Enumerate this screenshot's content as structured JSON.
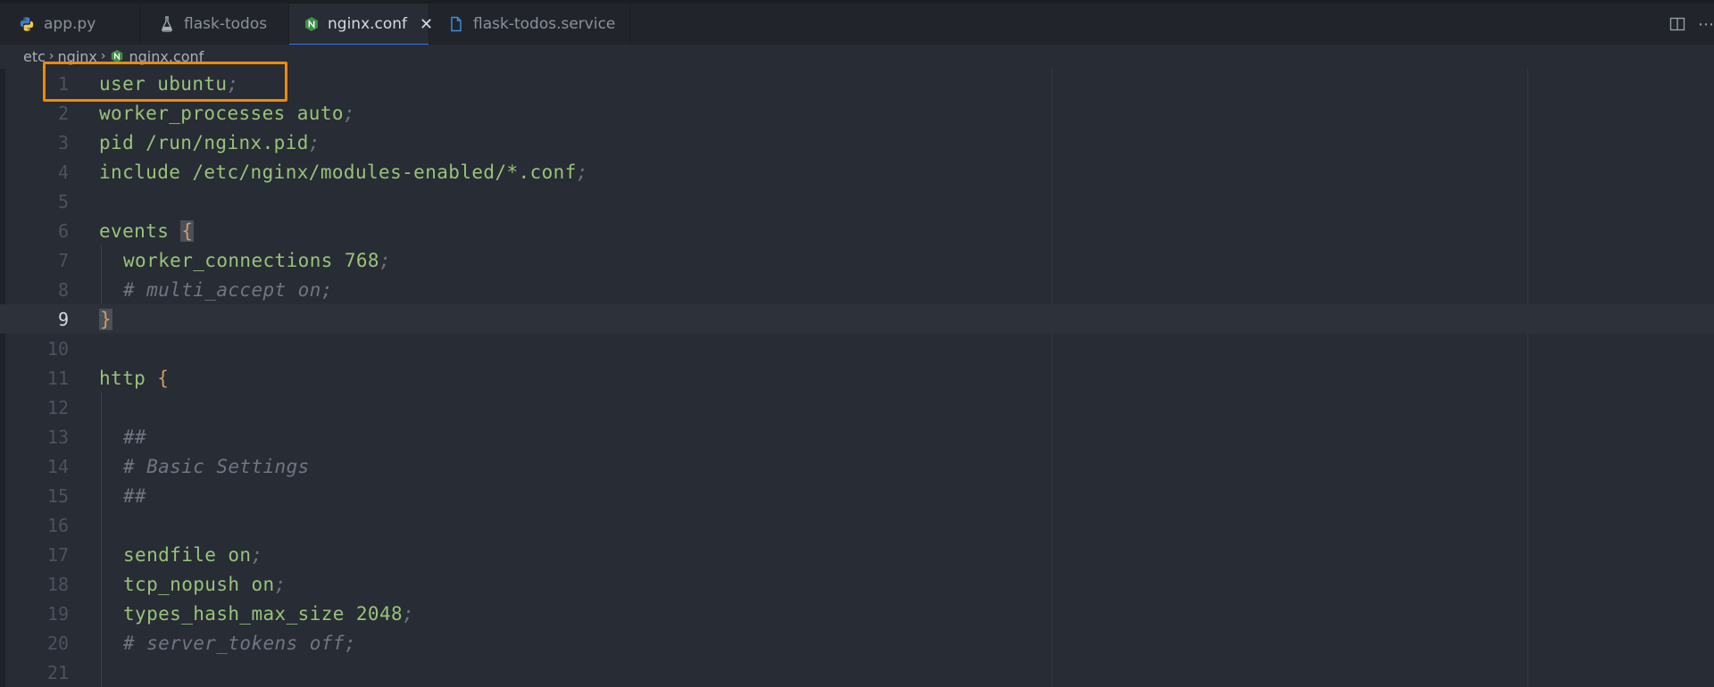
{
  "tabs": [
    {
      "label": "app.py",
      "icon": "python-icon",
      "active": false
    },
    {
      "label": "flask-todos",
      "icon": "flask-icon",
      "active": false
    },
    {
      "label": "nginx.conf",
      "icon": "nginx-icon",
      "active": true,
      "close": "✕"
    },
    {
      "label": "flask-todos.service",
      "icon": "file-icon",
      "active": false
    }
  ],
  "actions": {
    "split": "split-editor-icon",
    "more": "⋯"
  },
  "breadcrumb": {
    "parts": [
      "etc",
      "nginx",
      "nginx.conf"
    ],
    "separator": "›"
  },
  "editor": {
    "current_line": 9,
    "highlighted_line": 1,
    "lines": [
      {
        "n": "1",
        "code": "user ubuntu",
        "semi": ";"
      },
      {
        "n": "2",
        "code": "worker_processes auto",
        "semi": ";"
      },
      {
        "n": "3",
        "code": "pid /run/nginx.pid",
        "semi": ";"
      },
      {
        "n": "4",
        "code": "include /etc/nginx/modules-enabled/*.conf",
        "semi": ";"
      },
      {
        "n": "5",
        "code": "",
        "semi": ""
      },
      {
        "n": "6",
        "code": "events ",
        "brace": "{"
      },
      {
        "n": "7",
        "code": "worker_connections 768",
        "semi": ";"
      },
      {
        "n": "8",
        "comment": "# multi_accept on;"
      },
      {
        "n": "9",
        "brace": "}"
      },
      {
        "n": "10",
        "code": "",
        "semi": ""
      },
      {
        "n": "11",
        "code": "http ",
        "brace": "{"
      },
      {
        "n": "12",
        "code": "",
        "semi": ""
      },
      {
        "n": "13",
        "comment": "##"
      },
      {
        "n": "14",
        "comment": "# Basic Settings"
      },
      {
        "n": "15",
        "comment": "##"
      },
      {
        "n": "16",
        "code": "",
        "semi": ""
      },
      {
        "n": "17",
        "code": "sendfile on",
        "semi": ";"
      },
      {
        "n": "18",
        "code": "tcp_nopush on",
        "semi": ";"
      },
      {
        "n": "19",
        "code": "types_hash_max_size 2048",
        "semi": ";"
      },
      {
        "n": "20",
        "comment": "# server_tokens off;"
      },
      {
        "n": "21",
        "code": "",
        "semi": ""
      }
    ]
  },
  "colors": {
    "accent": "#f08a00",
    "keyword": "#98c379",
    "brace": "#d19a66",
    "comment": "#6f7683"
  }
}
